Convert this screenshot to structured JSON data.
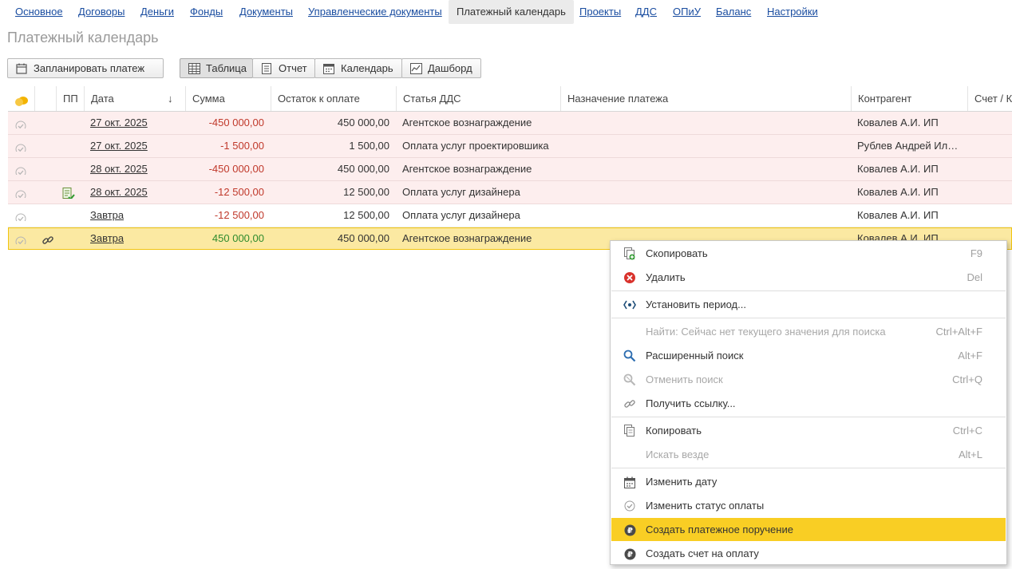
{
  "nav": {
    "items": [
      "Основное",
      "Договоры",
      "Деньги",
      "Фонды",
      "Документы",
      "Управленческие документы",
      "Платежный календарь",
      "Проекты",
      "ДДС",
      "ОПиУ",
      "Баланс",
      "Настройки"
    ]
  },
  "page": {
    "title": "Платежный календарь"
  },
  "toolbar": {
    "plan_payment": "Запланировать платеж",
    "views": [
      "Таблица",
      "Отчет",
      "Календарь",
      "Дашборд"
    ]
  },
  "table": {
    "columns": [
      "ПП",
      "Дата",
      "Сумма",
      "Остаток к оплате",
      "Статья ДДС",
      "Назначение платежа",
      "Контрагент",
      "Счет / К"
    ],
    "sort_indicator": "↓",
    "rows": [
      {
        "date": "27 окт. 2025",
        "amount": "-450 000,00",
        "remaining": "450 000,00",
        "article": "Агентское вознаграждение",
        "purpose": "",
        "counterparty": "Ковалев А.И. ИП"
      },
      {
        "date": "27 окт. 2025",
        "amount": "-1 500,00",
        "remaining": "1 500,00",
        "article": "Оплата услуг проектировшика",
        "purpose": "",
        "counterparty": "Рублев Андрей Ил…"
      },
      {
        "date": "28 окт. 2025",
        "amount": "-450 000,00",
        "remaining": "450 000,00",
        "article": "Агентское вознаграждение",
        "purpose": "",
        "counterparty": "Ковалев А.И. ИП"
      },
      {
        "date": "28 окт. 2025",
        "amount": "-12 500,00",
        "remaining": "12 500,00",
        "article": "Оплата услуг дизайнера",
        "purpose": "",
        "counterparty": "Ковалев А.И. ИП"
      },
      {
        "date": "Завтра",
        "amount": "-12 500,00",
        "remaining": "12 500,00",
        "article": "Оплата услуг дизайнера",
        "purpose": "",
        "counterparty": "Ковалев А.И. ИП"
      },
      {
        "date": "Завтра",
        "amount": "450 000,00",
        "remaining": "450 000,00",
        "article": "Агентское вознаграждение",
        "purpose": "",
        "counterparty": "Ковалев А.И. ИП"
      }
    ]
  },
  "context_menu": {
    "items": [
      {
        "label": "Скопировать",
        "shortcut": "F9"
      },
      {
        "label": "Удалить",
        "shortcut": "Del"
      },
      {
        "label": "Установить период...",
        "shortcut": ""
      },
      {
        "label": "Найти: Сейчас нет текущего значения для поиска",
        "shortcut": "Ctrl+Alt+F"
      },
      {
        "label": "Расширенный поиск",
        "shortcut": "Alt+F"
      },
      {
        "label": "Отменить поиск",
        "shortcut": "Ctrl+Q"
      },
      {
        "label": "Получить ссылку...",
        "shortcut": ""
      },
      {
        "label": "Копировать",
        "shortcut": "Ctrl+C"
      },
      {
        "label": "Искать везде",
        "shortcut": "Alt+L"
      },
      {
        "label": "Изменить дату",
        "shortcut": ""
      },
      {
        "label": "Изменить статус оплаты",
        "shortcut": ""
      },
      {
        "label": "Создать платежное поручение",
        "shortcut": ""
      },
      {
        "label": "Создать счет на оплату",
        "shortcut": ""
      }
    ]
  },
  "colors": {
    "accent_highlight": "#f9ce24",
    "overdue_row": "#fdeeee",
    "selected_row": "#fbe9a2",
    "negative": "#c0392b",
    "positive": "#2e8b2e",
    "link": "#1a4da0"
  }
}
